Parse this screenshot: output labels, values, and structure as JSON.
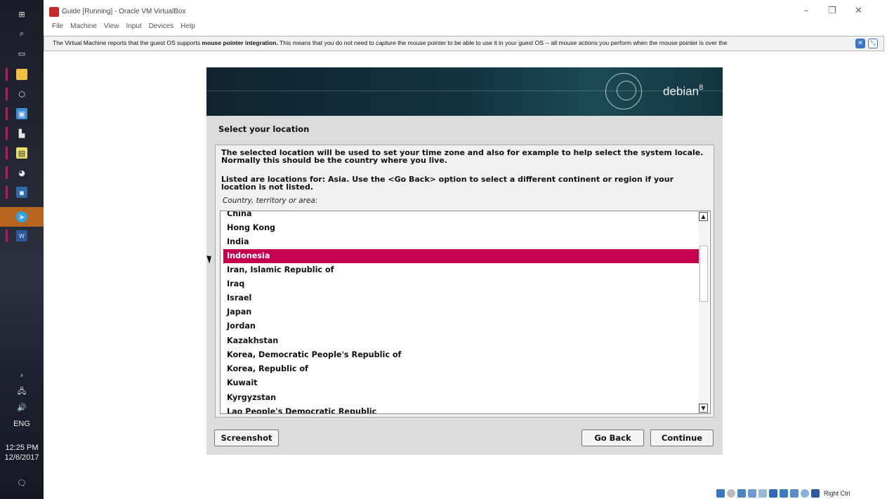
{
  "window": {
    "title": "Guide [Running] - Oracle VM VirtualBox",
    "menu": [
      "File",
      "Machine",
      "View",
      "Input",
      "Devices",
      "Help"
    ],
    "minimize_glyph": "–",
    "restore_glyph": "❐",
    "close_glyph": "✕"
  },
  "notice": {
    "text_before": "The Virtual Machine reports that the guest OS supports ",
    "text_bold": "mouse pointer integration.",
    "text_mid": " This means that you do not need to ",
    "text_italic": "capture",
    "text_after": " the mouse pointer to be able to use it in your guest OS -- all mouse actions you perform when the mouse pointer is over the"
  },
  "installer": {
    "logo": "debian",
    "logo_version": "8",
    "heading": "Select your location",
    "paragraph1": "The selected location will be used to set your time zone and also for example to help select the system locale. Normally this should be the country where you live.",
    "paragraph2": "Listed are locations for: Asia. Use the <Go Back> option to select a different continent or region if your location is not listed.",
    "list_label": "Country, territory or area:",
    "countries": [
      "China",
      "Hong Kong",
      "India",
      "Indonesia",
      "Iran, Islamic Republic of",
      "Iraq",
      "Israel",
      "Japan",
      "Jordan",
      "Kazakhstan",
      "Korea, Democratic People's Republic of",
      "Korea, Republic of",
      "Kuwait",
      "Kyrgyzstan",
      "Lao People's Democratic Republic"
    ],
    "selected": "Indonesia",
    "buttons": {
      "screenshot": "Screenshot",
      "go_back": "Go Back",
      "continue": "Continue"
    }
  },
  "taskbar": {
    "language": "ENG",
    "time": "12:25 PM",
    "date": "12/6/2017"
  },
  "statusbar": {
    "host_key": "Right Ctrl"
  },
  "colors": {
    "selection": "#c4004f",
    "banner": "#133240"
  }
}
